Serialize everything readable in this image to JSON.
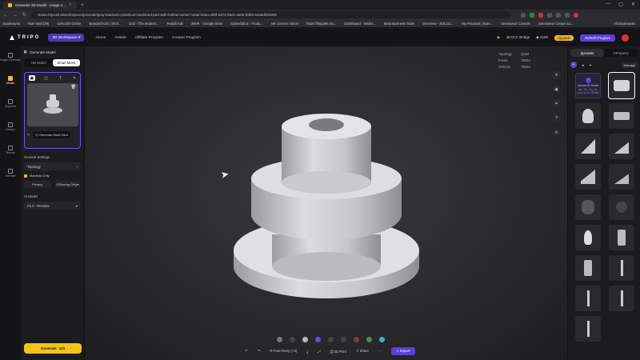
{
  "browser": {
    "tab_title": "Generate 3D Model - image o...",
    "url": "studio.tripo3d.ai/workspace/generate/gray-stacked-cylindrical-machined-part-with-hollow-center-metal-bedu-2d9f-a472-8bdc-4a06-b9b9-6ea8d906650",
    "bookmarks": [
      "Bookmarks",
      "Rule Wall (39)",
      "ooFLOW Online",
      "Branded kids | Shut...",
      "Dub - The Modern...",
      "Reddit Ads",
      "2BHK - Google Drive",
      "Subreddit.ai - Produ...",
      "NK Licence Admin",
      "https://blog365.my...",
      "Dashboard - WebH...",
      "Meta Business Suite",
      "Overview - 458.111...",
      "My Products | Bran...",
      "Streetwear Console",
      "Streetwear Create ad..."
    ],
    "all_bookmarks": "All Bookmarks"
  },
  "header": {
    "logo": "TRIPO",
    "workspace": "3D Workspace",
    "nav": [
      "Home",
      "Assets",
      "Affiliate Program",
      "Creator Program"
    ],
    "dcc": "DCC Bridge",
    "credits": "2186",
    "upgrade": "Upgrade",
    "refresh": "Refresh Program"
  },
  "rail": [
    {
      "label": "Image Generate",
      "icon": "image-icon"
    },
    {
      "label": "Model",
      "icon": "model-icon"
    },
    {
      "label": "Segment",
      "icon": "segment-icon"
    },
    {
      "label": "Retopo",
      "icon": "retopo-icon"
    },
    {
      "label": "Texture",
      "icon": "texture-icon"
    },
    {
      "label": "Animate",
      "icon": "animate-icon"
    }
  ],
  "left_panel": {
    "title": "Generate Model",
    "hd_model": "HD Model",
    "smart_mesh": "Smart Mesh",
    "multiview": "Generate Multi-View",
    "general_settings": "General Settings",
    "topology": "Topology",
    "manifold": "Manifold Only",
    "privacy": "Privacy",
    "sharing": "Sharing Only",
    "ai_model": "AI Model",
    "ai_model_value": "P1.0 - Preview",
    "generate": "Generate",
    "generate_cost": "120"
  },
  "canvas": {
    "topology_label": "Topology",
    "topology_value": "Quad",
    "faces_label": "Faces",
    "faces_value": "78004",
    "vertices_label": "Vertices",
    "vertices_value": "78004"
  },
  "action_bar": {
    "retry": "Free Retry (+3)",
    "print": "3D Print",
    "share": "Share",
    "export": "Export"
  },
  "right_panel": {
    "assets_tab": "Assets",
    "property_tab": "Property",
    "manage": "Manage",
    "upload": "Upload 3D Model",
    "upload_sub": "glb, fbx, obj, stl, usdz up to 200MB"
  }
}
